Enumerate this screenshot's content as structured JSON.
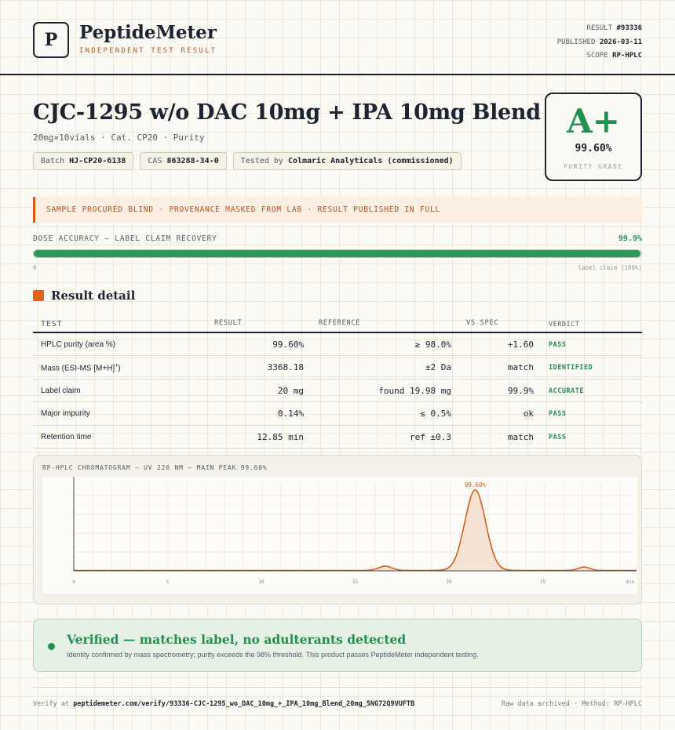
{
  "brand": {
    "logo_letter": "P",
    "name": "PeptideMeter",
    "tagline": "INDEPENDENT TEST RESULT"
  },
  "meta": {
    "result_label": "RESULT",
    "result_value": "#93336",
    "published_label": "PUBLISHED",
    "published_value": "2026-03-11",
    "scope_label": "SCOPE",
    "scope_value": "RP-HPLC"
  },
  "product": {
    "title": "CJC-1295 w/o DAC 10mg + IPA 10mg Blend",
    "subtitle": "20mg×10vials · Cat. CP20 · Purity",
    "batch_label": "Batch",
    "batch_value": "HJ-CP20-6138",
    "cas_label": "CAS",
    "cas_value": "863288-34-0",
    "tested_label": "Tested by",
    "tested_value": "Colmaric Analyticals (commissioned)"
  },
  "grade": {
    "letter": "A+",
    "value": "99.60%",
    "label": "PURITY GRADE"
  },
  "banner": "SAMPLE PROCURED BLIND · PROVENANCE MASKED FROM LAB · RESULT PUBLISHED IN FULL",
  "dose": {
    "label": "DOSE ACCURACY — LABEL CLAIM RECOVERY",
    "pct_text": "99.9%",
    "fraction": 0.999,
    "min_label": "0",
    "max_label": "label claim (100%)"
  },
  "section_title": "Result detail",
  "table": {
    "headers": {
      "test": "TEST",
      "result": "RESULT",
      "reference": "REFERENCE",
      "vs": "VS SPEC",
      "verdict": "VERDICT"
    },
    "rows": [
      {
        "test": "HPLC purity (area %)",
        "result": "99.60%",
        "reference": "≥ 98.0%",
        "vs": "+1.60",
        "verdict": "PASS"
      },
      {
        "test": "Mass (ESI-MS [M+H]",
        "test_sup": "+",
        "test_suffix": ")",
        "result": "3368.18",
        "reference": "±2 Da",
        "vs": "match",
        "verdict": "IDENTIFIED"
      },
      {
        "test": "Label claim",
        "result": "20 mg",
        "reference": "found 19.98 mg",
        "vs": "99.9%",
        "verdict": "ACCURATE"
      },
      {
        "test": "Major impurity",
        "result": "0.14%",
        "reference": "≤ 0.5%",
        "vs": "ok",
        "verdict": "PASS"
      },
      {
        "test": "Retention time",
        "result": "12.85 min",
        "reference": "ref ±0.3",
        "vs": "match",
        "verdict": "PASS"
      }
    ]
  },
  "chromatogram": {
    "title": "RP-HPLC CHROMATOGRAM — UV 220 NM — MAIN PEAK 99.60%"
  },
  "chart_data": {
    "type": "line",
    "title": "RP-HPLC CHROMATOGRAM — UV 220 NM — MAIN PEAK 99.60%",
    "xlabel": "",
    "ylabel": "",
    "x_ticks": [
      "0",
      "5",
      "10",
      "15",
      "20",
      "25",
      "min"
    ],
    "xlim": [
      0,
      30
    ],
    "ylim": [
      0,
      100
    ],
    "grid": true,
    "annotation": "99.60%",
    "baseline": 0.5,
    "peaks": [
      {
        "center": 16.6,
        "height": 5,
        "width": 0.35
      },
      {
        "center": 21.4,
        "height": 95,
        "width": 0.55
      },
      {
        "center": 27.2,
        "height": 4,
        "width": 0.3
      }
    ],
    "colors": {
      "line": "#d0621e",
      "fill": "#f7e3d4"
    }
  },
  "verified": {
    "title": "Verified — matches label, no adulterants detected",
    "subtitle": "Identity confirmed by mass spectrometry; purity exceeds the 98% threshold. This product passes PeptideMeter independent testing."
  },
  "footer": {
    "verify_label": "Verify at",
    "verify_url": "peptidemeter.com/verify/93336-CJC-1295_wo_DAC_10mg_+_IPA_10mg_Blend_20mg_5NG72Q9VUFTB",
    "right": "Raw data archived · Method: RP-HPLC"
  },
  "colors": {
    "accent": "#e2621c",
    "pass": "#23904f",
    "ink": "#1d2330"
  }
}
